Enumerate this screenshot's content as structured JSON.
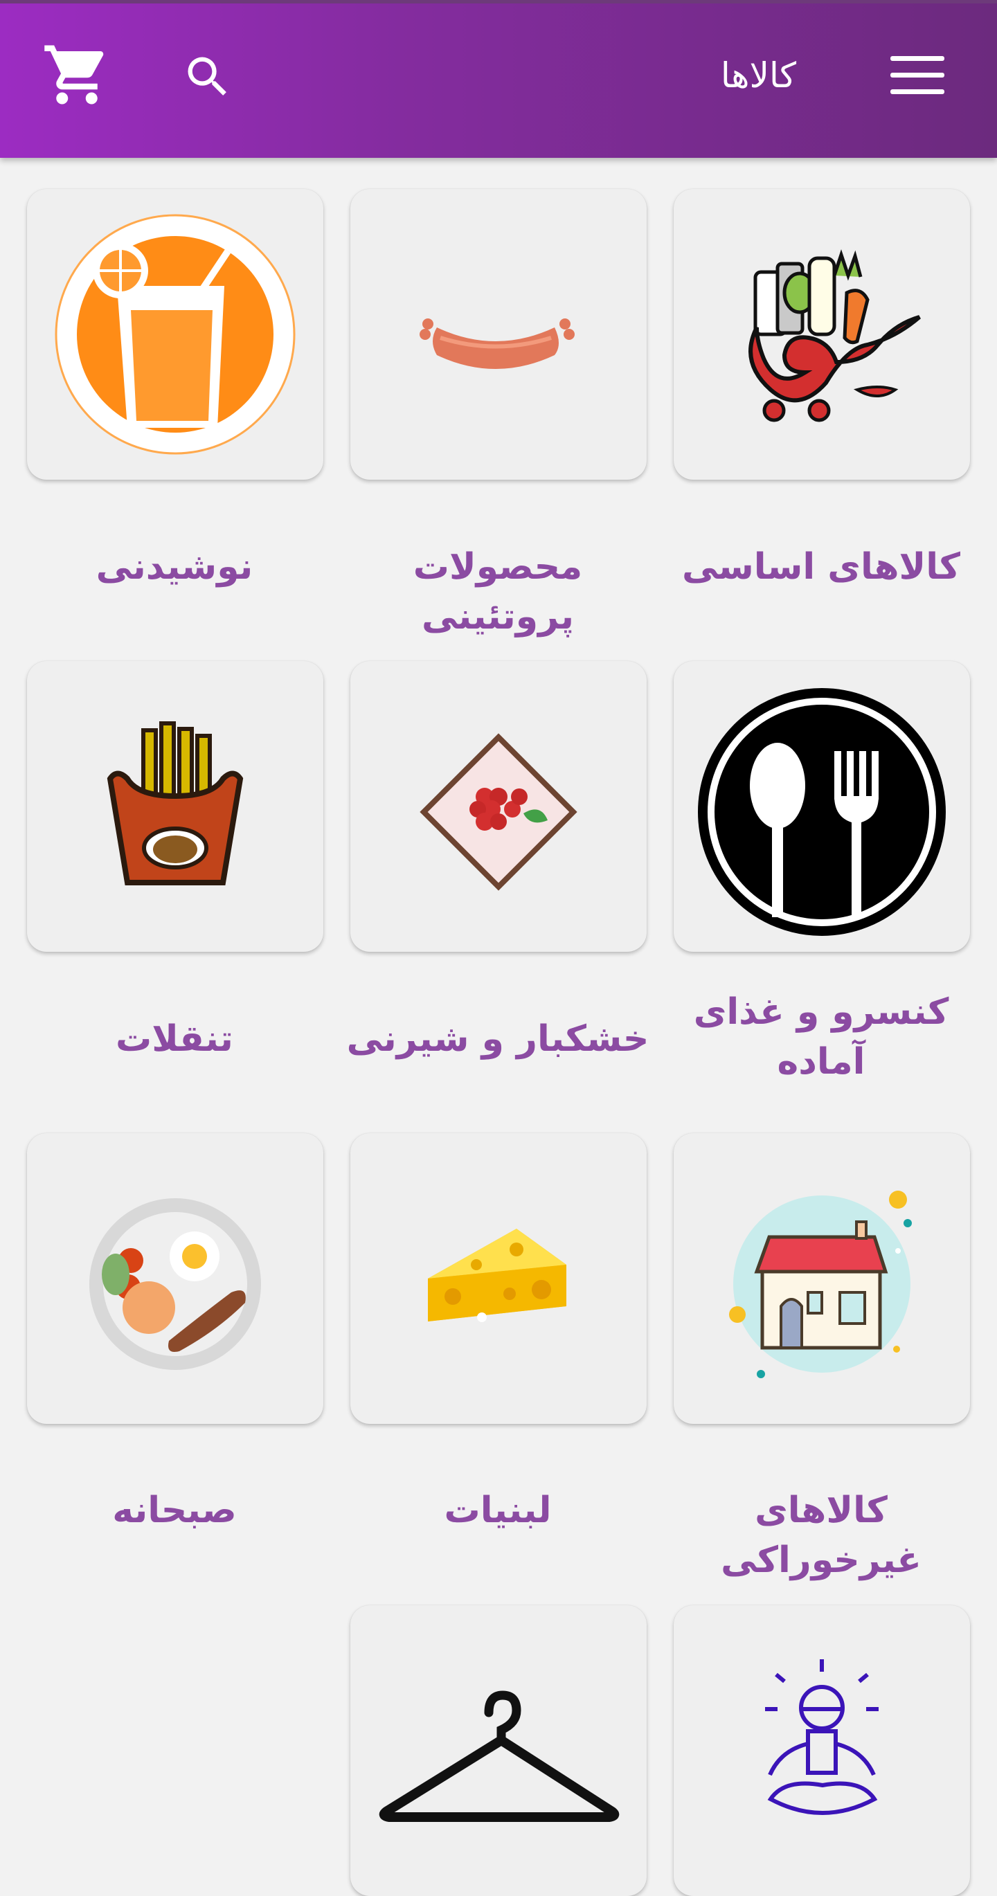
{
  "appbar": {
    "title": "کالاها",
    "icons": [
      "menu-icon",
      "search-icon",
      "cart-icon"
    ],
    "color_start": "#9c2cc2",
    "color_end": "#6c2a7e"
  },
  "categories": [
    {
      "label": "کالاهای اساسی",
      "icon": "grocery-basket-icon"
    },
    {
      "label": "محصولات پروتئینی",
      "icon": "sausage-icon"
    },
    {
      "label": "نوشیدنی",
      "icon": "juice-glass-icon"
    },
    {
      "label": "کنسرو و غذای آماده",
      "icon": "spoon-fork-icon"
    },
    {
      "label": "خشکبار و شیرنی",
      "icon": "raspberry-pastry-icon"
    },
    {
      "label": "تنقلات",
      "icon": "french-fries-icon"
    },
    {
      "label": "کالاهای غیرخوراکی",
      "icon": "house-icon"
    },
    {
      "label": "لبنیات",
      "icon": "cheese-icon"
    },
    {
      "label": "صبحانه",
      "icon": "breakfast-plate-icon"
    },
    {
      "label": "",
      "icon": "meditation-icon"
    },
    {
      "label": "",
      "icon": "hanger-icon"
    }
  ],
  "label_color": "#8b4ba2"
}
